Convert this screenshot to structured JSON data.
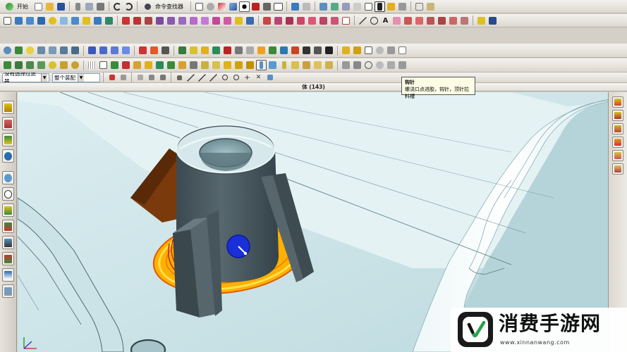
{
  "toolbar": {
    "start_label": "开始",
    "command_finder_label": "命令查找器"
  },
  "filter_bar": {
    "selection_filter_value": "没有选择过滤器",
    "scope_value": "整个装配"
  },
  "graphics_window": {
    "title": "体 (143)"
  },
  "tooltip": {
    "title": "钩针",
    "description": "螺浇口点进胶，钩针，顶针拉料槽"
  },
  "watermark": {
    "site_name": "消费手游网",
    "url": "www.xinnanwang.com"
  },
  "colors": {
    "model_body": "#4a5a60",
    "plate_surface": "#bcd9de",
    "background_plate": "#c6e2e6",
    "highlight_yellow": "#ffcc00",
    "selection_blue": "#1a2fd8",
    "brown_face": "#7a3a0c"
  },
  "icons": {
    "row1": [
      "start-icon",
      "new-icon",
      "open-icon",
      "save-icon",
      "cut-icon",
      "copy-icon",
      "paste-icon",
      "undo-icon",
      "redo-icon",
      "command-finder-icon",
      "snap-view-icon",
      "fit-icon",
      "zoom-icon",
      "shade-icon",
      "wireframe-icon",
      "background-icon",
      "orient-icon",
      "layer-icon",
      "render-icon",
      "measure-icon",
      "move-icon"
    ],
    "row2": [
      "sketch-icon",
      "curve-icon",
      "extrude-icon",
      "revolve-icon",
      "hole-icon",
      "boss-icon",
      "pocket-icon",
      "pad-icon",
      "edge-blend-icon",
      "chamfer-icon",
      "shell-icon",
      "draft-icon",
      "trim-body-icon",
      "unite-icon",
      "subtract-icon",
      "intersect-icon",
      "mirror-icon",
      "pattern-icon",
      "offset-icon",
      "thicken-icon",
      "sew-icon",
      "text-icon",
      "arc-icon",
      "line-icon",
      "spline-icon"
    ],
    "row3": [
      "view-icon",
      "visibility-icon",
      "light-icon",
      "camera-icon",
      "section-icon",
      "layout-icon",
      "grid-icon",
      "mold-wizard-icon",
      "parting-icon",
      "core-icon",
      "cavity-icon",
      "insert-icon",
      "slider-icon",
      "lifter-icon",
      "ejector-pin-icon",
      "sprue-icon",
      "runner-icon",
      "gate-icon",
      "cooling-icon",
      "electrode-icon",
      "pocket-cut-icon",
      "bom-icon",
      "drawing-icon"
    ],
    "row4": [
      "select-icon",
      "point-icon",
      "line-snap-icon",
      "arc-snap-icon",
      "center-snap-icon",
      "quadrant-icon",
      "intersection-icon",
      "endpoint-icon",
      "midpoint-icon",
      "grid-snap-icon"
    ]
  }
}
